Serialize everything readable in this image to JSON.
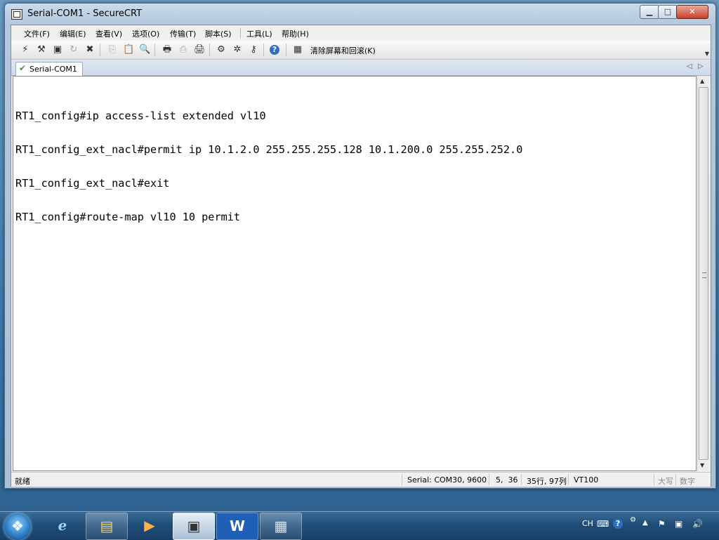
{
  "window": {
    "title": "Serial-COM1 - SecureCRT",
    "min_label": "▁",
    "max_label": "□",
    "close_label": "✕"
  },
  "menu": [
    {
      "label": "文件(F)"
    },
    {
      "label": "编辑(E)"
    },
    {
      "label": "查看(V)"
    },
    {
      "label": "选项(O)"
    },
    {
      "label": "传输(T)"
    },
    {
      "label": "脚本(S)"
    },
    {
      "label": "工具(L)"
    },
    {
      "label": "帮助(H)"
    }
  ],
  "toolbar": {
    "clear_label": "清除屏幕和回滚(K)",
    "icons": [
      {
        "name": "connect-icon",
        "glyph": "⚡"
      },
      {
        "name": "quick-connect-icon",
        "glyph": "⚒"
      },
      {
        "name": "connect-tab-icon",
        "glyph": "▣"
      },
      {
        "name": "reconnect-icon",
        "glyph": "↻"
      },
      {
        "name": "disconnect-icon",
        "glyph": "✖"
      },
      {
        "name": "copy-icon",
        "glyph": "⎘"
      },
      {
        "name": "paste-icon",
        "glyph": "📋"
      },
      {
        "name": "find-icon",
        "glyph": "🔍"
      },
      {
        "name": "print-icon",
        "glyph": "🖶"
      },
      {
        "name": "print-selection-icon",
        "glyph": "⎙"
      },
      {
        "name": "printer-icon",
        "glyph": "🖨"
      },
      {
        "name": "session-options-icon",
        "glyph": "⚙"
      },
      {
        "name": "global-options-icon",
        "glyph": "✲"
      },
      {
        "name": "keymap-icon",
        "glyph": "⚷"
      },
      {
        "name": "help-icon",
        "glyph": "?"
      },
      {
        "name": "clear-screen-icon",
        "glyph": "▦"
      }
    ]
  },
  "tab": {
    "label": "Serial-COM1",
    "prev_icon": "◁",
    "next_icon": "▷"
  },
  "terminal": {
    "lines": [
      "RT1_config#ip access-list extended vl10",
      "RT1_config_ext_nacl#permit ip 10.1.2.0 255.255.255.128 10.1.200.0 255.255.252.0",
      "RT1_config_ext_nacl#exit",
      "RT1_config#route-map vl10 10 permit"
    ]
  },
  "status": {
    "ready": "就绪",
    "connection": "Serial: COM30, 9600",
    "cursor": "5,  36",
    "size": "35行, 97列",
    "emulation": "VT100",
    "caps": "大写",
    "num": "数字"
  },
  "taskbar": {
    "ime": "CH",
    "apps": [
      {
        "name": "ie-icon",
        "glyph": "e"
      },
      {
        "name": "explorer-icon",
        "glyph": "▤"
      },
      {
        "name": "media-player-icon",
        "glyph": "▶"
      },
      {
        "name": "securecrt-task-icon",
        "glyph": "▣"
      },
      {
        "name": "word-icon",
        "glyph": "W"
      },
      {
        "name": "notepad-icon",
        "glyph": "▦"
      }
    ]
  }
}
